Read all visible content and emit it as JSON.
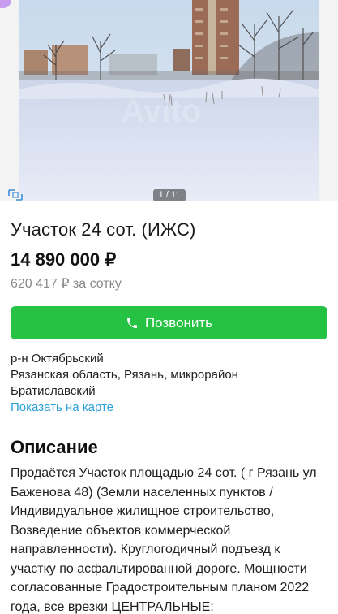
{
  "gallery": {
    "counter": "1 / 11",
    "watermark": "Avito"
  },
  "listing": {
    "title": "Участок 24 сот. (ИЖС)",
    "price": "14 890 000 ₽",
    "price_per_unit": "620 417 ₽ за сотку"
  },
  "actions": {
    "call_label": "Позвонить"
  },
  "address": {
    "district": "р-н Октябрьский",
    "full": "Рязанская область, Рязань, микрорайон Братиславский",
    "map_link": "Показать на карте"
  },
  "description": {
    "heading": "Описание",
    "text": "Продаётся Участок площадью 24 сот. ( г Рязань ул Баженова 48) (Земли населенных пунктов / Индивидуальное жилищное строительство, Возведение объектов коммерческой направленности). Круглогодичный подъезд к участку по асфальтированной дороге. Мощности согласованные Градостроительным планом 2022 года, все врезки ЦЕНТРАЛЬНЫЕ:"
  },
  "colors": {
    "accent_green": "#26c243",
    "link_blue": "#2aa1d9"
  }
}
